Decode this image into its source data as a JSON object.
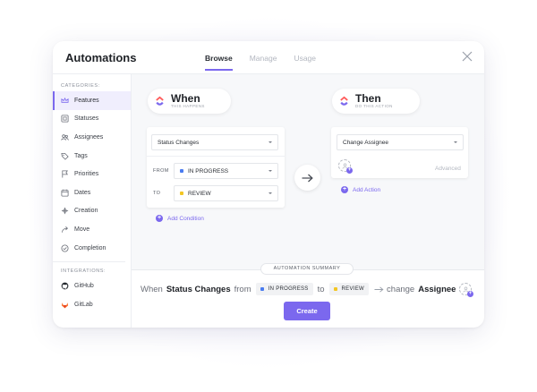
{
  "header": {
    "title": "Automations",
    "tabs": [
      "Browse",
      "Manage",
      "Usage"
    ],
    "active_tab": "Browse"
  },
  "sidebar": {
    "categories_label": "CATEGORIES:",
    "categories": [
      {
        "label": "Features",
        "icon": "crown-icon",
        "active": true
      },
      {
        "label": "Statuses",
        "icon": "status-icon"
      },
      {
        "label": "Assignees",
        "icon": "users-icon"
      },
      {
        "label": "Tags",
        "icon": "tag-icon"
      },
      {
        "label": "Priorities",
        "icon": "flag-icon"
      },
      {
        "label": "Dates",
        "icon": "calendar-icon"
      },
      {
        "label": "Creation",
        "icon": "create-icon"
      },
      {
        "label": "Move",
        "icon": "move-icon"
      },
      {
        "label": "Completion",
        "icon": "check-circle-icon"
      }
    ],
    "integrations_label": "INTEGRATIONS:",
    "integrations": [
      {
        "label": "GitHub",
        "icon": "github-icon"
      },
      {
        "label": "GitLab",
        "icon": "gitlab-icon"
      }
    ]
  },
  "when": {
    "title": "When",
    "subtitle": "THIS HAPPENS",
    "trigger": "Status Changes",
    "from_label": "FROM",
    "from_value": "IN PROGRESS",
    "to_label": "TO",
    "to_value": "REVIEW",
    "add_condition": "Add Condition"
  },
  "then": {
    "title": "Then",
    "subtitle": "DO THIS ACTION",
    "action": "Change Assignee",
    "advanced": "Advanced",
    "add_action": "Add Action"
  },
  "summary": {
    "label": "AUTOMATION SUMMARY",
    "when_word": "When",
    "trigger": "Status Changes",
    "from_word": "from",
    "from_status": "IN PROGRESS",
    "to_word": "to",
    "to_status": "REVIEW",
    "change_word": "change",
    "target": "Assignee"
  },
  "create_button": "Create",
  "colors": {
    "accent": "#7b68ee",
    "in_progress": "#4a7cf0",
    "review": "#f3c623"
  }
}
